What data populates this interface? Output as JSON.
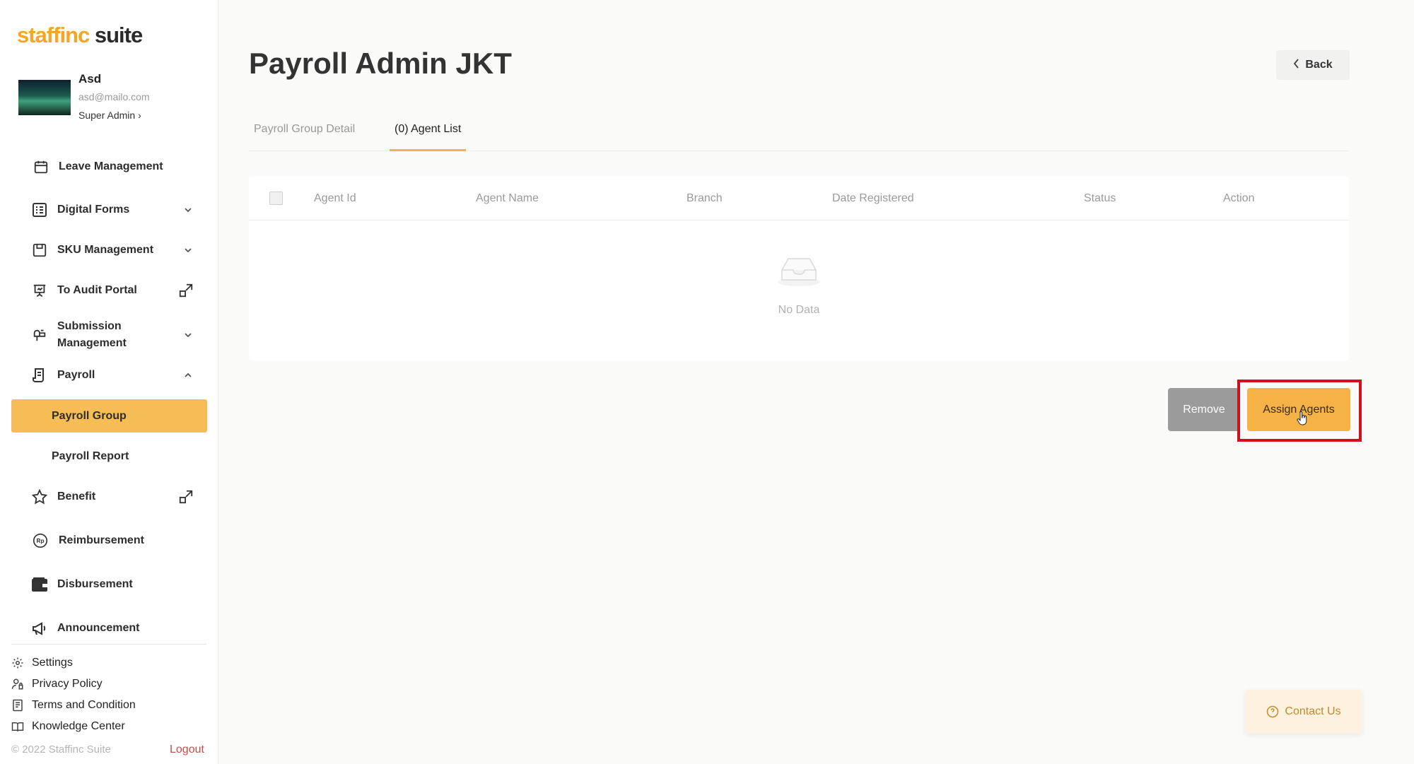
{
  "sidebar": {
    "logo": {
      "brand": "staffinc",
      "suite": " suite"
    },
    "profile": {
      "name": "Asd",
      "email": "asd@mailo.com",
      "role": "Super Admin",
      "role_chevron": "›"
    },
    "items": [
      {
        "label": "Leave Management",
        "icon": "calendar-icon"
      },
      {
        "label": "Digital Forms",
        "icon": "form-list-icon",
        "expandable": true
      },
      {
        "label": "SKU Management",
        "icon": "box-icon",
        "expandable": true
      },
      {
        "label": "To Audit Portal",
        "icon": "presentation-icon",
        "external": true
      },
      {
        "label": "Submission",
        "label2": "Management",
        "icon": "mailbox-icon",
        "expandable": true
      },
      {
        "label": "Payroll",
        "icon": "receipt-icon",
        "expanded": true
      },
      {
        "label": "Benefit",
        "icon": "star-icon",
        "external": true
      },
      {
        "label": "Reimbursement",
        "icon": "rupiah-icon"
      },
      {
        "label": "Disbursement",
        "icon": "wallet-icon"
      },
      {
        "label": "Announcement",
        "icon": "megaphone-icon"
      }
    ],
    "payroll_sub": [
      {
        "label": "Payroll Group",
        "active": true
      },
      {
        "label": "Payroll Report",
        "active": false
      }
    ],
    "footer_links": [
      {
        "label": "Settings",
        "icon": "gear-icon"
      },
      {
        "label": "Privacy Policy",
        "icon": "privacy-icon"
      },
      {
        "label": "Terms and Condition",
        "icon": "document-icon"
      },
      {
        "label": "Knowledge Center",
        "icon": "book-icon"
      }
    ],
    "copyright": "© 2022 Staffinc Suite",
    "logout": "Logout"
  },
  "main": {
    "title": "Payroll Admin JKT",
    "back_label": "Back",
    "tabs": [
      {
        "label": "Payroll Group Detail",
        "active": false
      },
      {
        "label": "(0) Agent List",
        "active": true
      }
    ],
    "table": {
      "columns": [
        "Agent Id",
        "Agent Name",
        "Branch",
        "Date Registered",
        "Status",
        "Action"
      ],
      "rows": [],
      "empty_text": "No Data"
    },
    "actions": {
      "remove_label": "Remove",
      "assign_label": "Assign Agents"
    },
    "contact_label": "Contact Us"
  },
  "colors": {
    "accent": "#f5b347",
    "active_nav": "#f6bd56",
    "highlight": "#d0101c",
    "logout": "#c0504d"
  }
}
